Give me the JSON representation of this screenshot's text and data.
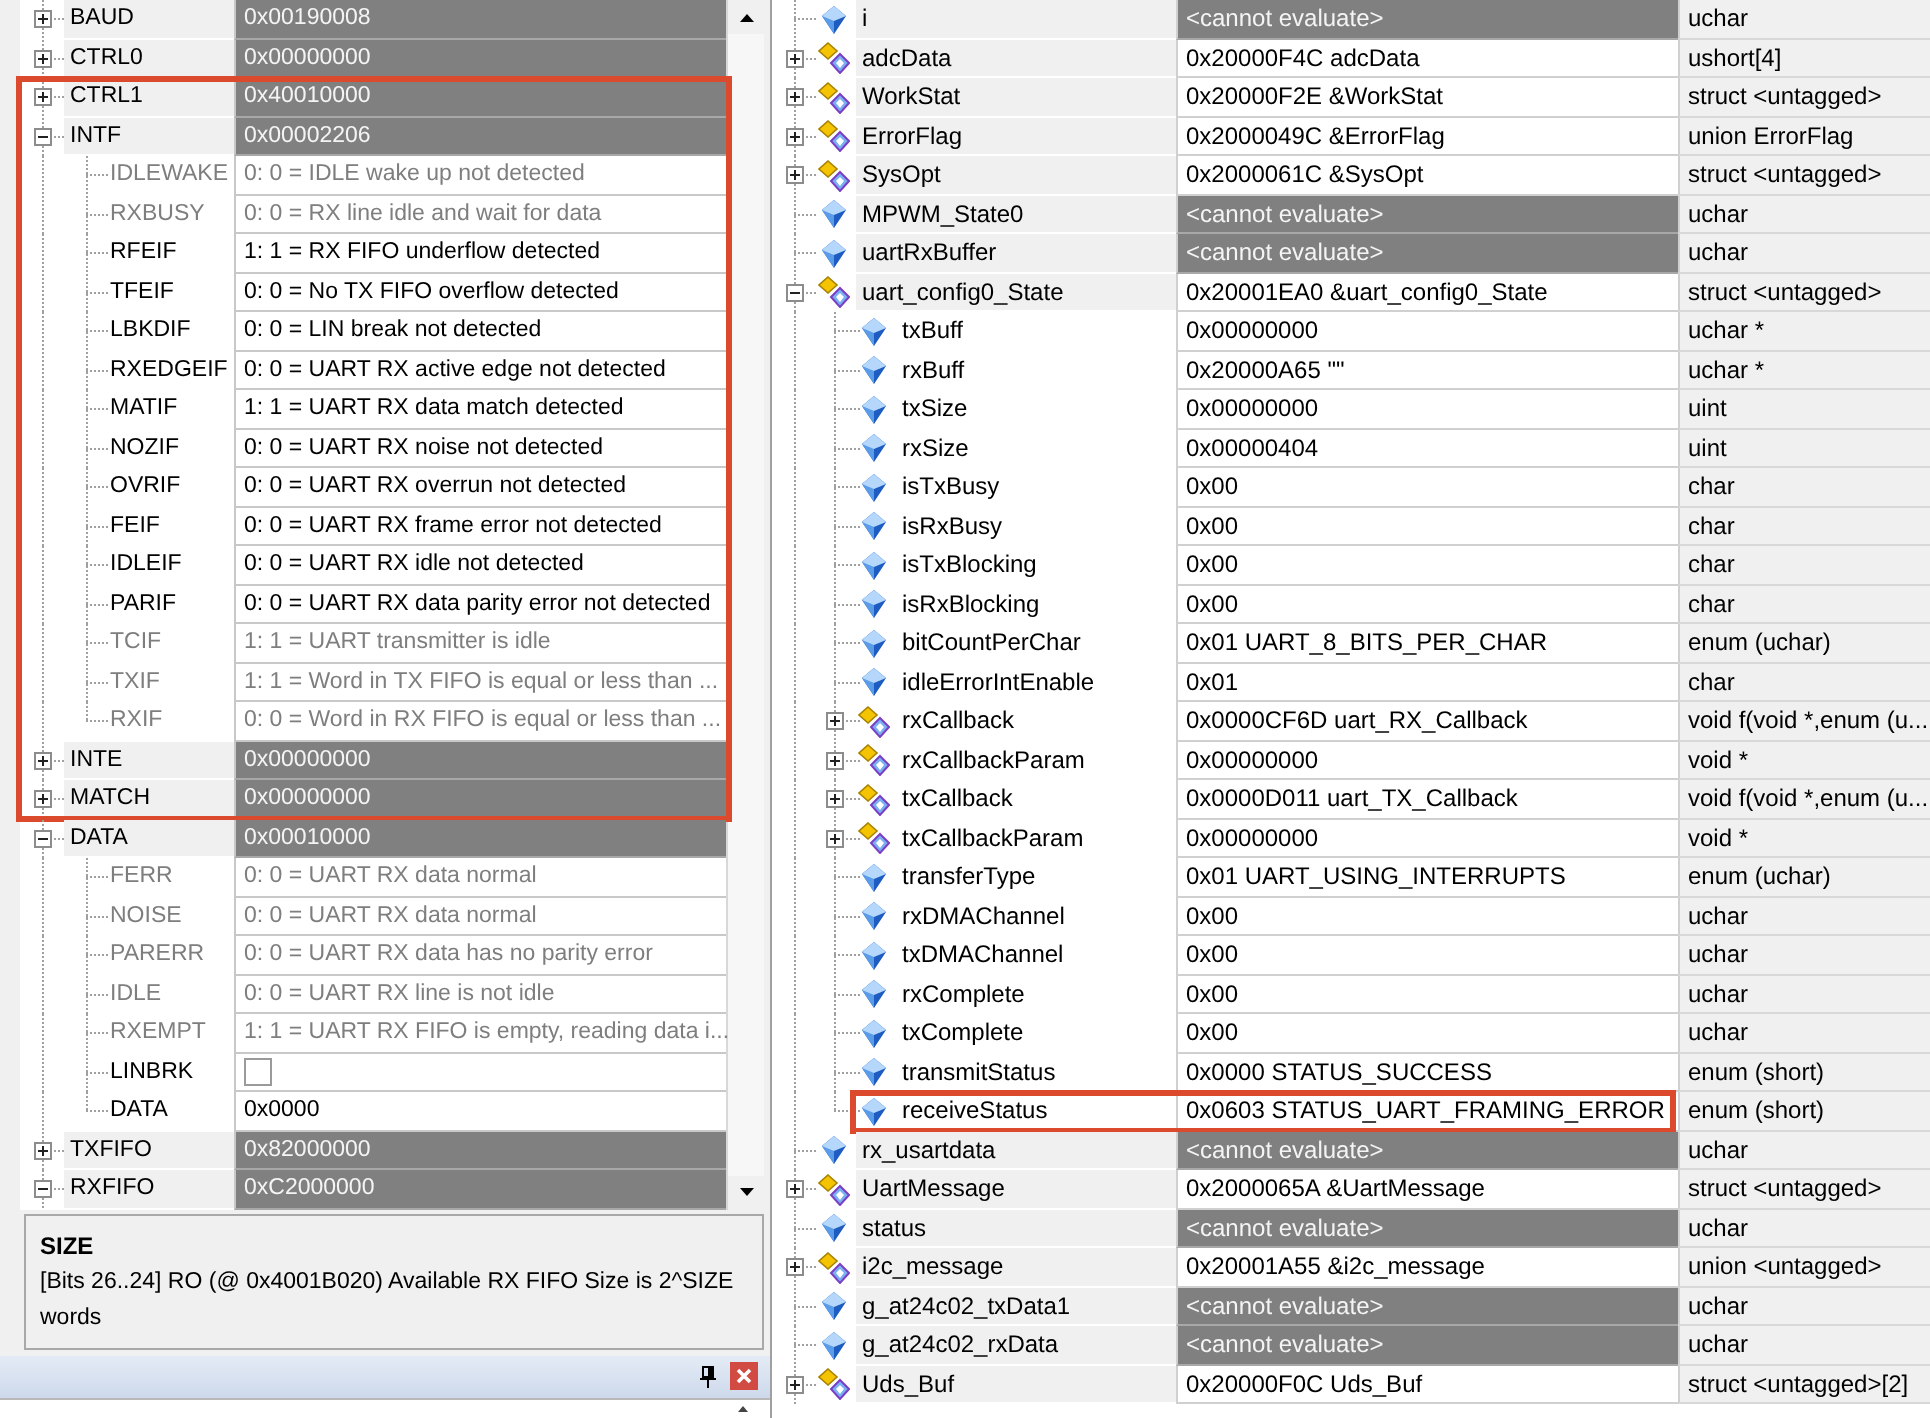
{
  "peripheral": {
    "rows": [
      {
        "name": "BAUD",
        "value": "0x00190008",
        "expanded": false,
        "highlighted": false
      },
      {
        "name": "CTRL0",
        "value": "0x00000000",
        "expanded": false,
        "highlighted": false
      },
      {
        "name": "CTRL1",
        "value": "0x40010000",
        "expanded": false,
        "highlighted": true
      },
      {
        "name": "INTF",
        "value": "0x00002206",
        "expanded": true,
        "highlighted": true,
        "children": [
          {
            "kind": "text",
            "name": "IDLEWAKE",
            "value": "0: 0 = IDLE wake up not detected",
            "read_only": true
          },
          {
            "kind": "text",
            "name": "RXBUSY",
            "value": "0: 0 = RX line idle and wait for data",
            "read_only": true
          },
          {
            "kind": "text",
            "name": "RFEIF",
            "value": "1: 1 = RX FIFO underflow detected",
            "read_only": false
          },
          {
            "kind": "text",
            "name": "TFEIF",
            "value": "0: 0 = No TX FIFO overflow detected",
            "read_only": false
          },
          {
            "kind": "text",
            "name": "LBKDIF",
            "value": "0: 0 = LIN break not detected",
            "read_only": false
          },
          {
            "kind": "text",
            "name": "RXEDGEIF",
            "value": "0: 0 = UART RX active edge not detected",
            "read_only": false
          },
          {
            "kind": "text",
            "name": "MATIF",
            "value": "1: 1 = UART RX data match detected",
            "read_only": false
          },
          {
            "kind": "text",
            "name": "NOZIF",
            "value": "0: 0 = UART RX noise not detected",
            "read_only": false
          },
          {
            "kind": "text",
            "name": "OVRIF",
            "value": "0: 0 = UART RX overrun not detected",
            "read_only": false
          },
          {
            "kind": "text",
            "name": "FEIF",
            "value": "0: 0 = UART RX frame error not detected",
            "read_only": false
          },
          {
            "kind": "text",
            "name": "IDLEIF",
            "value": "0: 0 = UART RX idle not detected",
            "read_only": false
          },
          {
            "kind": "text",
            "name": "PARIF",
            "value": "0: 0 = UART RX data parity error not detected",
            "read_only": false
          },
          {
            "kind": "text",
            "name": "TCIF",
            "value": "1: 1 = UART transmitter is idle",
            "read_only": true
          },
          {
            "kind": "text",
            "name": "TXIF",
            "value": "1: 1 = Word in TX FIFO is equal or less than ...",
            "read_only": true
          },
          {
            "kind": "text",
            "name": "RXIF",
            "value": "0: 0 = Word in RX FIFO is equal or less than ...",
            "read_only": true
          }
        ]
      },
      {
        "name": "INTE",
        "value": "0x00000000",
        "expanded": false,
        "highlighted": true
      },
      {
        "name": "MATCH",
        "value": "0x00000000",
        "expanded": false,
        "highlighted": true
      },
      {
        "name": "DATA",
        "value": "0x00010000",
        "expanded": true,
        "highlighted": false,
        "children": [
          {
            "kind": "text",
            "name": "FERR",
            "value": "0: 0 = UART RX data normal",
            "read_only": true
          },
          {
            "kind": "text",
            "name": "NOISE",
            "value": "0: 0 = UART RX data normal",
            "read_only": true
          },
          {
            "kind": "text",
            "name": "PARERR",
            "value": "0: 0 = UART RX data has no parity error",
            "read_only": true
          },
          {
            "kind": "text",
            "name": "IDLE",
            "value": "0: 0 = UART RX line is not idle",
            "read_only": true
          },
          {
            "kind": "text",
            "name": "RXEMPT",
            "value": "1: 1 = UART RX FIFO is empty, reading data i...",
            "read_only": true
          },
          {
            "kind": "checkbox",
            "name": "LINBRK",
            "checked": false,
            "read_only": false
          },
          {
            "kind": "text",
            "name": "DATA",
            "value": "0x0000",
            "read_only": false
          }
        ]
      },
      {
        "name": "TXFIFO",
        "value": "0x82000000",
        "expanded": false,
        "highlighted": false
      },
      {
        "name": "RXFIFO",
        "value": "0xC2000000",
        "expanded": true,
        "highlighted": false
      }
    ]
  },
  "description": {
    "title": "SIZE",
    "text": "[Bits 26..24] RO (@ 0x4001B020) Available RX FIFO Size is 2^SIZE words"
  },
  "watch": {
    "rows": [
      {
        "kind": "scalar",
        "name": "i",
        "value": "<cannot evaluate>",
        "type": "uchar",
        "evaluated": false,
        "highlighted": false
      },
      {
        "kind": "struct",
        "name": "adcData",
        "value": "0x20000F4C adcData",
        "type": "ushort[4]",
        "expanded": false,
        "evaluated": true,
        "highlighted": false
      },
      {
        "kind": "struct",
        "name": "WorkStat",
        "value": "0x20000F2E &WorkStat",
        "type": "struct <untagged>",
        "expanded": false,
        "evaluated": true,
        "highlighted": false
      },
      {
        "kind": "struct",
        "name": "ErrorFlag",
        "value": "0x2000049C &ErrorFlag",
        "type": "union ErrorFlag",
        "expanded": false,
        "evaluated": true,
        "highlighted": false
      },
      {
        "kind": "struct",
        "name": "SysOpt",
        "value": "0x2000061C &SysOpt",
        "type": "struct <untagged>",
        "expanded": false,
        "evaluated": true,
        "highlighted": false
      },
      {
        "kind": "scalar",
        "name": "MPWM_State0",
        "value": "<cannot evaluate>",
        "type": "uchar",
        "evaluated": false,
        "highlighted": false
      },
      {
        "kind": "scalar",
        "name": "uartRxBuffer",
        "value": "<cannot evaluate>",
        "type": "uchar",
        "evaluated": false,
        "highlighted": false
      },
      {
        "kind": "struct",
        "name": "uart_config0_State",
        "value": "0x20001EA0 &uart_config0_State",
        "type": "struct <untagged>",
        "expanded": true,
        "evaluated": true,
        "highlighted": false,
        "children": [
          {
            "kind": "scalar",
            "name": "txBuff",
            "value": "0x00000000",
            "type": "uchar *",
            "evaluated": true,
            "highlighted": false
          },
          {
            "kind": "scalar",
            "name": "rxBuff",
            "value": "0x20000A65 \"\"",
            "type": "uchar *",
            "evaluated": true,
            "highlighted": false
          },
          {
            "kind": "scalar",
            "name": "txSize",
            "value": "0x00000000",
            "type": "uint",
            "evaluated": true,
            "highlighted": false
          },
          {
            "kind": "scalar",
            "name": "rxSize",
            "value": "0x00000404",
            "type": "uint",
            "evaluated": true,
            "highlighted": false
          },
          {
            "kind": "scalar",
            "name": "isTxBusy",
            "value": "0x00",
            "type": "char",
            "evaluated": true,
            "highlighted": false
          },
          {
            "kind": "scalar",
            "name": "isRxBusy",
            "value": "0x00",
            "type": "char",
            "evaluated": true,
            "highlighted": false
          },
          {
            "kind": "scalar",
            "name": "isTxBlocking",
            "value": "0x00",
            "type": "char",
            "evaluated": true,
            "highlighted": false
          },
          {
            "kind": "scalar",
            "name": "isRxBlocking",
            "value": "0x00",
            "type": "char",
            "evaluated": true,
            "highlighted": false
          },
          {
            "kind": "scalar",
            "name": "bitCountPerChar",
            "value": "0x01 UART_8_BITS_PER_CHAR",
            "type": "enum (uchar)",
            "evaluated": true,
            "highlighted": false
          },
          {
            "kind": "scalar",
            "name": "idleErrorIntEnable",
            "value": "0x01",
            "type": "char",
            "evaluated": true,
            "highlighted": false
          },
          {
            "kind": "struct",
            "name": "rxCallback",
            "value": "0x0000CF6D uart_RX_Callback",
            "type": "void f(void *,enum (u...",
            "expanded": false,
            "evaluated": true,
            "highlighted": false
          },
          {
            "kind": "struct",
            "name": "rxCallbackParam",
            "value": "0x00000000",
            "type": "void *",
            "expanded": false,
            "evaluated": true,
            "highlighted": false
          },
          {
            "kind": "struct",
            "name": "txCallback",
            "value": "0x0000D011 uart_TX_Callback",
            "type": "void f(void *,enum (u...",
            "expanded": false,
            "evaluated": true,
            "highlighted": false
          },
          {
            "kind": "struct",
            "name": "txCallbackParam",
            "value": "0x00000000",
            "type": "void *",
            "expanded": false,
            "evaluated": true,
            "highlighted": false
          },
          {
            "kind": "scalar",
            "name": "transferType",
            "value": "0x01 UART_USING_INTERRUPTS",
            "type": "enum (uchar)",
            "evaluated": true,
            "highlighted": false
          },
          {
            "kind": "scalar",
            "name": "rxDMAChannel",
            "value": "0x00",
            "type": "uchar",
            "evaluated": true,
            "highlighted": false
          },
          {
            "kind": "scalar",
            "name": "txDMAChannel",
            "value": "0x00",
            "type": "uchar",
            "evaluated": true,
            "highlighted": false
          },
          {
            "kind": "scalar",
            "name": "rxComplete",
            "value": "0x00",
            "type": "uchar",
            "evaluated": true,
            "highlighted": false
          },
          {
            "kind": "scalar",
            "name": "txComplete",
            "value": "0x00",
            "type": "uchar",
            "evaluated": true,
            "highlighted": false
          },
          {
            "kind": "scalar",
            "name": "transmitStatus",
            "value": "0x0000 STATUS_SUCCESS",
            "type": "enum (short)",
            "evaluated": true,
            "highlighted": false
          },
          {
            "kind": "scalar",
            "name": "receiveStatus",
            "value": "0x0603 STATUS_UART_FRAMING_ERROR",
            "type": "enum (short)",
            "evaluated": true,
            "highlighted": true
          }
        ]
      },
      {
        "kind": "scalar",
        "name": "rx_usartdata",
        "value": "<cannot evaluate>",
        "type": "uchar",
        "evaluated": false,
        "highlighted": false
      },
      {
        "kind": "struct",
        "name": "UartMessage",
        "value": "0x2000065A &UartMessage",
        "type": "struct <untagged>",
        "expanded": false,
        "evaluated": true,
        "highlighted": false
      },
      {
        "kind": "scalar",
        "name": "status",
        "value": "<cannot evaluate>",
        "type": "uchar",
        "evaluated": false,
        "highlighted": false
      },
      {
        "kind": "struct",
        "name": "i2c_message",
        "value": "0x20001A55 &i2c_message",
        "type": "union <untagged>",
        "expanded": false,
        "evaluated": true,
        "highlighted": false
      },
      {
        "kind": "scalar",
        "name": "g_at24c02_txData1",
        "value": "<cannot evaluate>",
        "type": "uchar",
        "evaluated": false,
        "highlighted": false
      },
      {
        "kind": "scalar",
        "name": "g_at24c02_rxData",
        "value": "<cannot evaluate>",
        "type": "uchar",
        "evaluated": false,
        "highlighted": false
      },
      {
        "kind": "struct",
        "name": "Uds_Buf",
        "value": "0x20000F0C Uds_Buf",
        "type": "struct <untagged>[2]",
        "expanded": false,
        "evaluated": true,
        "highlighted": false
      }
    ]
  }
}
